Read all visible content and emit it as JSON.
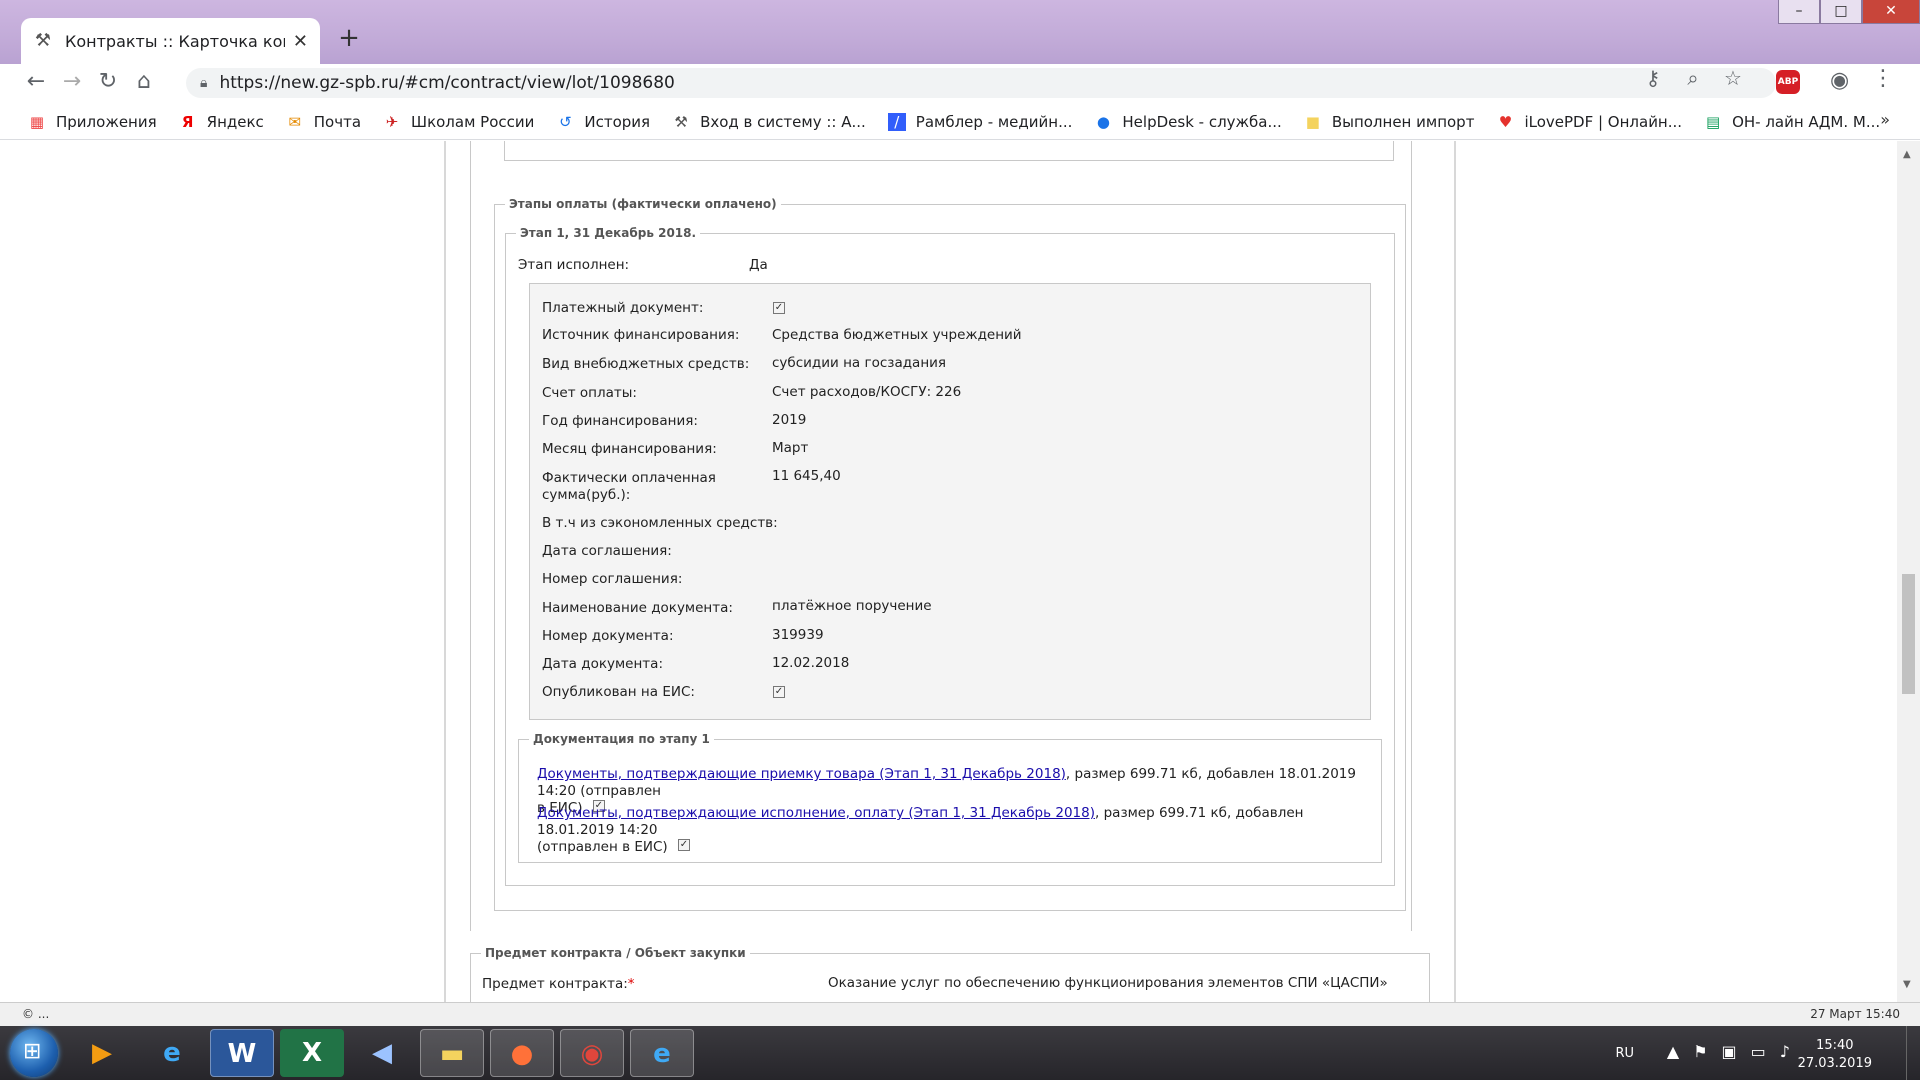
{
  "browser": {
    "tab_title": "Контракты :: Карточка контракт",
    "url": "https://new.gz-spb.ru/#cm/contract/view/lot/1098680"
  },
  "bookmarks": [
    {
      "label": "Приложения",
      "icon": "apps-grid-icon"
    },
    {
      "label": "Яндекс",
      "icon": "yandex-icon"
    },
    {
      "label": "Почта",
      "icon": "mail-icon"
    },
    {
      "label": "Школам России",
      "icon": "school-icon"
    },
    {
      "label": "История",
      "icon": "history-icon"
    },
    {
      "label": "Вход в систему :: А...",
      "icon": "tools-icon"
    },
    {
      "label": "Рамблер - медийн...",
      "icon": "rambler-icon"
    },
    {
      "label": "HelpDesk - служба...",
      "icon": "help-icon"
    },
    {
      "label": "Выполнен импорт",
      "icon": "folder-icon"
    },
    {
      "label": "iLovePDF | Онлайн...",
      "icon": "heart-icon"
    },
    {
      "label": "ОН- лайн АДМ. М...",
      "icon": "sheet-icon"
    }
  ],
  "payments": {
    "legend": "Этапы оплаты (фактически оплачено)",
    "stage_legend": "Этап 1, 31 Декабрь 2018.",
    "stage_done_label": "Этап исполнен:",
    "stage_done_value": "Да",
    "fields": {
      "doc_label": "Платежный документ:",
      "source_label": "Источник финансирования:",
      "source_value": "Средства бюджетных учреждений",
      "kind_label": "Вид внебюджетных средств:",
      "kind_value": "субсидии на госзадания",
      "account_label": "Счет оплаты:",
      "account_value": "Счет расходов/КОСГУ: 226",
      "year_label": "Год финансирования:",
      "year_value": "2019",
      "month_label": "Месяц финансирования:",
      "month_value": "Март",
      "paid_label_1": "Фактически оплаченная",
      "paid_label_2": "сумма(руб.):",
      "paid_value": "11 645,40",
      "saved_label": "В т.ч из сэкономленных средств:",
      "agr_date_label": "Дата соглашения:",
      "agr_num_label": "Номер соглашения:",
      "docname_label": "Наименование документа:",
      "docname_value": "платёжное поручение",
      "docnum_label": "Номер документа:",
      "docnum_value": "319939",
      "docdate_label": "Дата документа:",
      "docdate_value": "12.02.2018",
      "eis_label": "Опубликован на ЕИС:"
    },
    "docs_legend": "Документация по этапу 1",
    "docs": [
      {
        "link": "Документы, подтверждающие приемку товара (Этап 1, 31 Декабрь 2018)",
        "rest1": ", размер 699.71 кб, добавлен 18.01.2019 14:20 (отправлен",
        "rest2": "в ЕИС)"
      },
      {
        "link": "Документы, подтверждающие исполнение, оплату (Этап 1, 31 Декабрь 2018)",
        "rest1": ", размер 699.71 кб, добавлен 18.01.2019 14:20",
        "rest2": "(отправлен в ЕИС)"
      }
    ]
  },
  "subject": {
    "legend": "Предмет контракта / Объект закупки",
    "label": "Предмет контракта:",
    "required": "*",
    "value": "Оказание услуг по обеспечению функционирования элементов СПИ «ЦАСПИ»"
  },
  "status": {
    "left": "© ...",
    "right": "27 Март 15:40"
  },
  "taskbar": {
    "lang": "RU",
    "time": "15:40",
    "date": "27.03.2019"
  }
}
